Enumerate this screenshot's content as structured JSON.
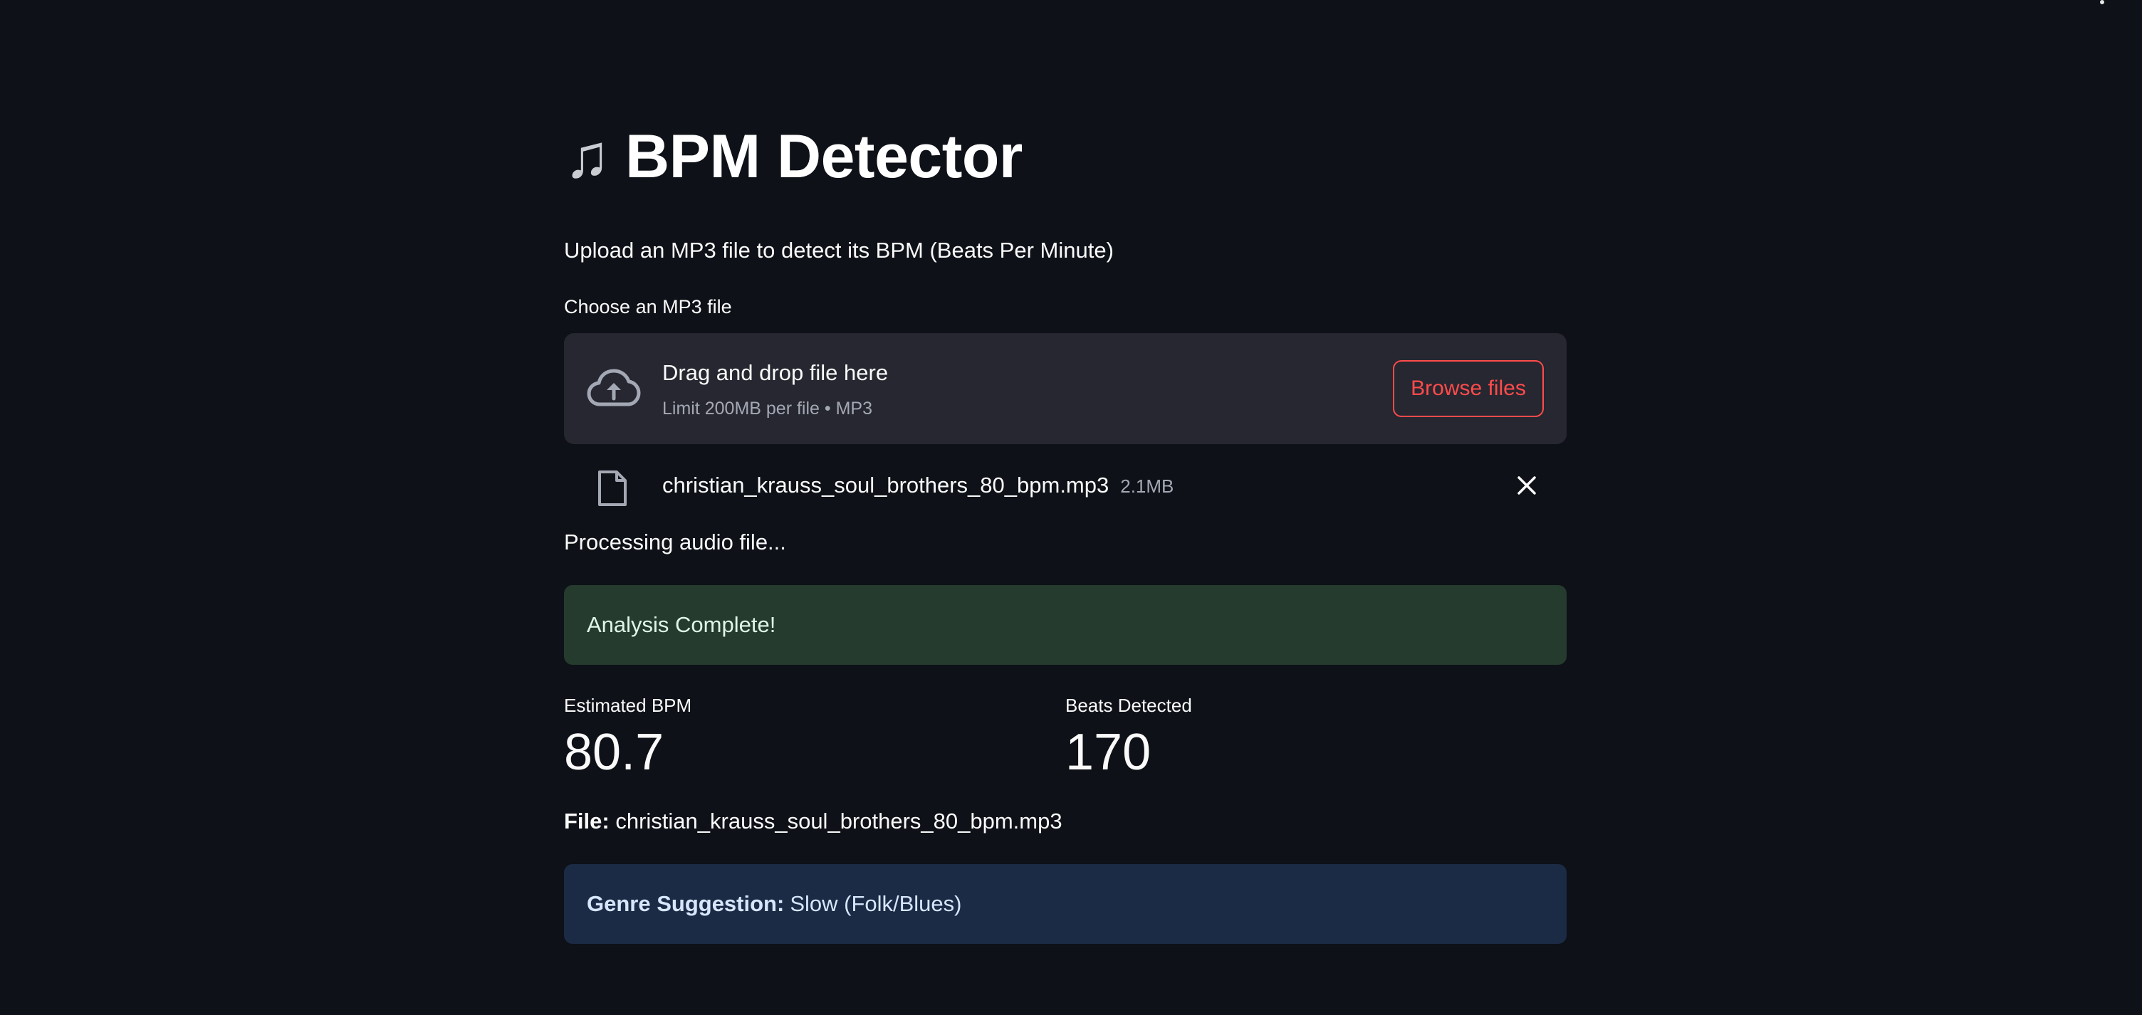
{
  "app": {
    "title": "BPM Detector",
    "title_icon": "musical-notes-icon",
    "subtitle": "Upload an MP3 file to detect its BPM (Beats Per Minute)"
  },
  "uploader": {
    "label": "Choose an MP3 file",
    "dropzone_title": "Drag and drop file here",
    "dropzone_limit": "Limit 200MB per file • MP3",
    "browse_label": "Browse files",
    "accent_color": "#ff4b4b"
  },
  "uploaded_file": {
    "name": "christian_krauss_soul_brothers_80_bpm.mp3",
    "size": "2.1MB"
  },
  "status": {
    "processing": "Processing audio file...",
    "success": "Analysis Complete!"
  },
  "metrics": [
    {
      "label": "Estimated BPM",
      "value": "80.7"
    },
    {
      "label": "Beats Detected",
      "value": "170"
    }
  ],
  "file_line": {
    "label": "File:",
    "value": "christian_krauss_soul_brothers_80_bpm.mp3"
  },
  "genre": {
    "label": "Genre Suggestion:",
    "value": "Slow (Folk/Blues)"
  },
  "colors": {
    "background": "#0e1117",
    "success_bg": "#253b2e",
    "info_bg": "#1c2b45",
    "dropzone_bg": "#262730"
  }
}
